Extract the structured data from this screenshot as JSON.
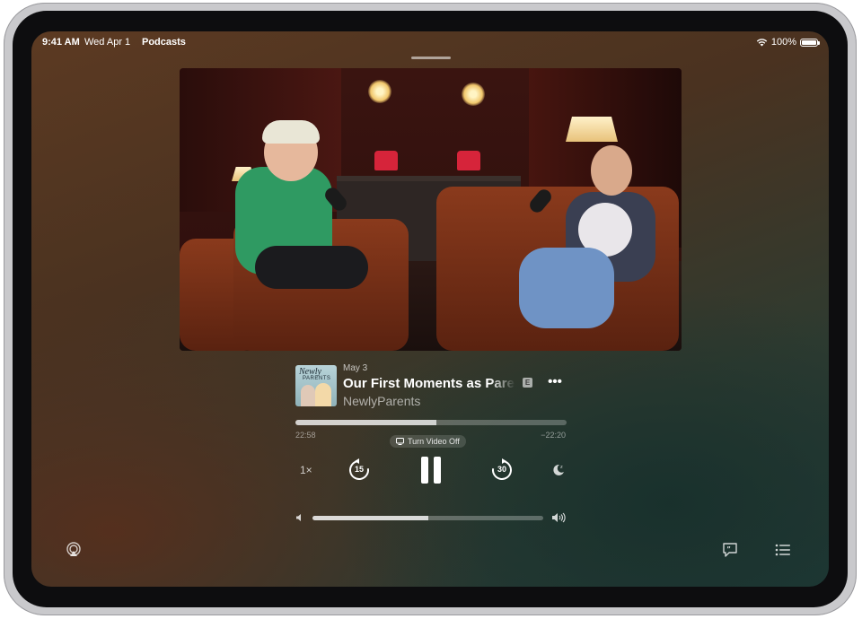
{
  "status_bar": {
    "time": "9:41 AM",
    "date": "Wed Apr 1",
    "app": "Podcasts",
    "battery": "100%"
  },
  "episode": {
    "date": "May 3",
    "title": "Our First Moments as Parents",
    "explicit_badge": "E",
    "show": "NewlyParents",
    "more_label": "•••"
  },
  "artwork": {
    "line1": "Newly",
    "line2": "PARENTS"
  },
  "playback": {
    "elapsed": "22:58",
    "remaining": "−22:20",
    "progress": 0.52,
    "video_toggle_label": "Turn Video Off",
    "speed_label": "1×",
    "skip_back_seconds": "15",
    "skip_forward_seconds": "30"
  },
  "volume": {
    "level": 0.5
  },
  "icons": {
    "wifi": "wifi-icon",
    "battery": "battery-icon",
    "tv": "tv-icon",
    "skip_back": "skip-back-15-icon",
    "pause": "pause-icon",
    "skip_forward": "skip-forward-30-icon",
    "sleep": "sleep-timer-icon",
    "volume_low": "speaker-low-icon",
    "volume_high": "speaker-high-icon",
    "airplay": "airplay-icon",
    "lyrics": "transcript-icon",
    "queue": "queue-list-icon"
  },
  "colors": {
    "accent": "#ffffff",
    "background_warm": "#5c3a22",
    "background_cool": "#1f3a37"
  }
}
